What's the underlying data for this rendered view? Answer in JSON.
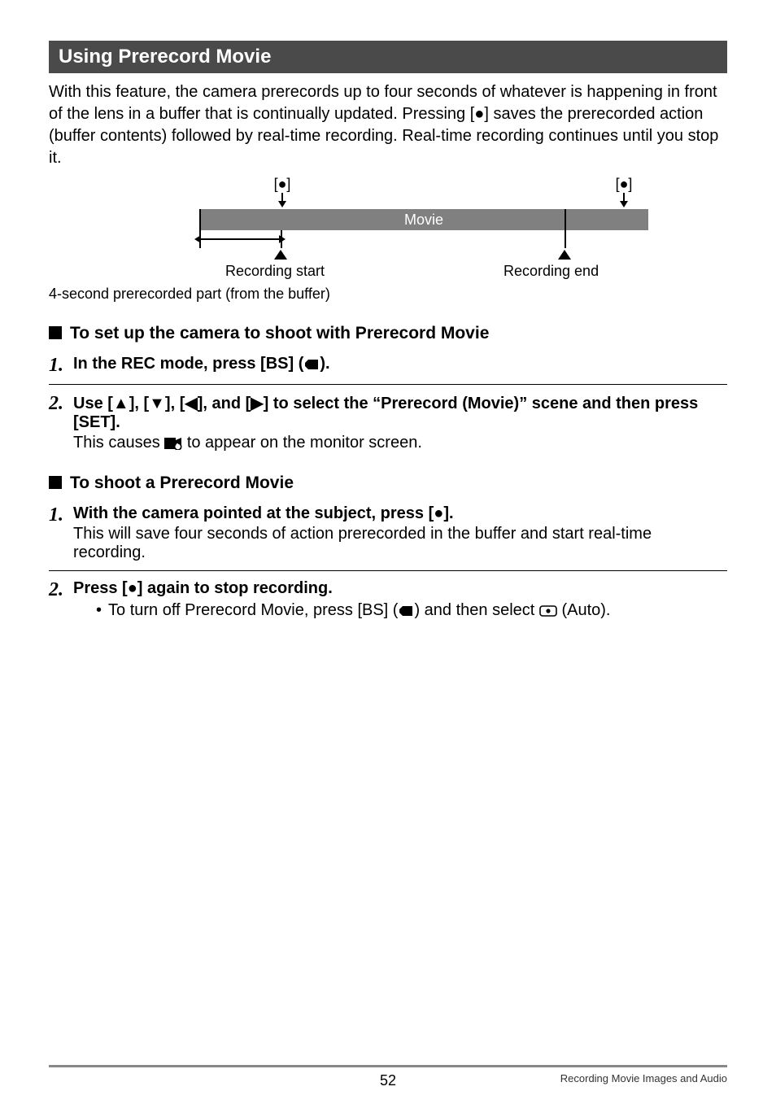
{
  "section": {
    "title": "Using Prerecord Movie"
  },
  "intro": "With this feature, the camera prerecords up to four seconds of whatever is happening in front of the lens in a buffer that is continually updated. Pressing [●] saves the prerecorded action (buffer contents) followed by real-time recording. Real-time recording continues until you stop it.",
  "diagram": {
    "top_left": "[●]",
    "top_right": "[●]",
    "bar_label": "Movie",
    "rec_start": "Recording start",
    "rec_end": "Recording end",
    "buffer_label": "4-second prerecorded part (from the buffer)"
  },
  "subhead1": "To set up the camera to shoot with Prerecord Movie",
  "step1_1": {
    "num": "1.",
    "title_a": "In the REC mode, press [BS] (",
    "title_b": ")."
  },
  "step1_2": {
    "num": "2.",
    "title": "Use [▲], [▼], [◀], and [▶] to select the “Prerecord (Movie)” scene and then press [SET].",
    "desc_a": "This causes ",
    "desc_b": " to appear on the monitor screen."
  },
  "subhead2": "To shoot a Prerecord Movie",
  "step2_1": {
    "num": "1.",
    "title": "With the camera pointed at the subject, press [●].",
    "desc": "This will save four seconds of action prerecorded in the buffer and start real-time recording."
  },
  "step2_2": {
    "num": "2.",
    "title": "Press [●] again to stop recording.",
    "bullet_a": "To turn off Prerecord Movie, press [BS] (",
    "bullet_b": ") and then select ",
    "bullet_c": " (Auto)."
  },
  "footer": {
    "page": "52",
    "chapter": "Recording Movie Images and Audio"
  }
}
